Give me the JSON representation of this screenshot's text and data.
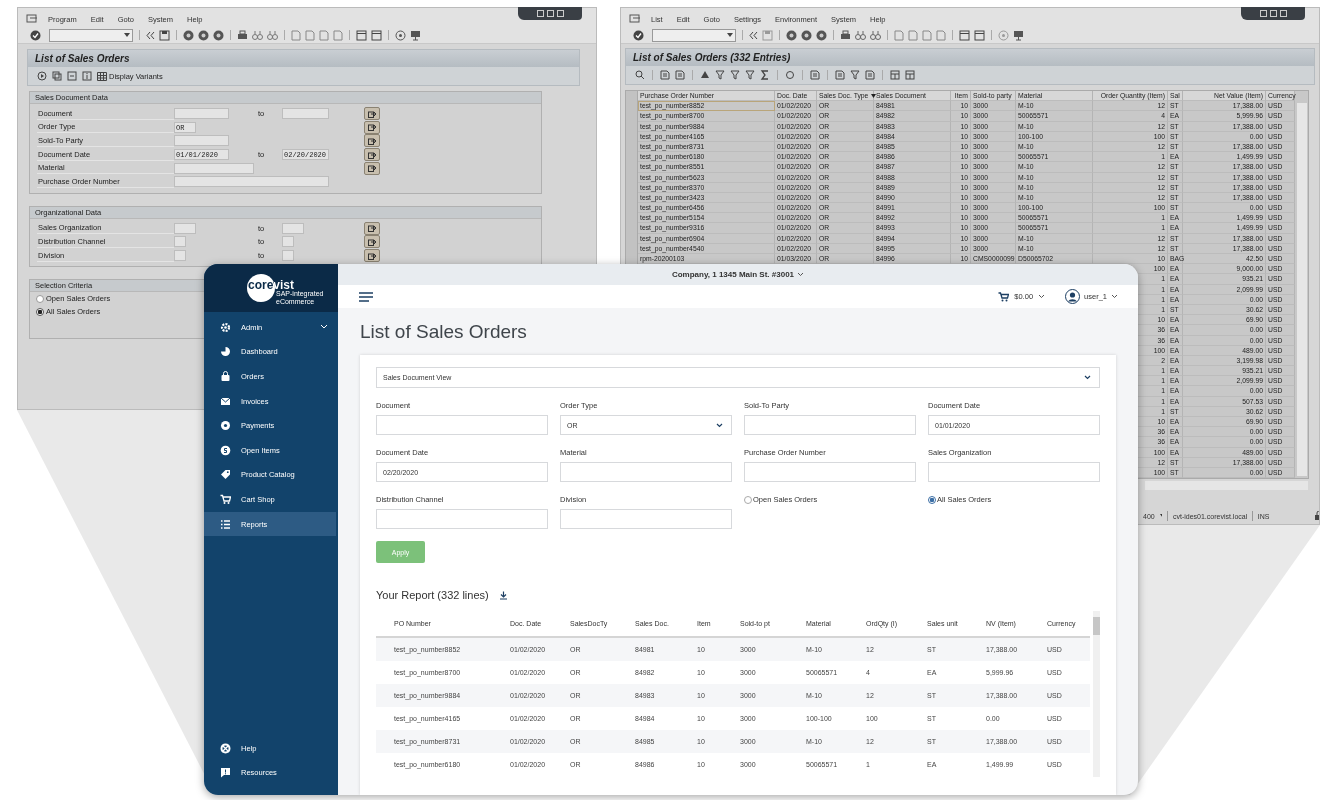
{
  "sap_selection_window": {
    "menu": [
      "Program",
      "Edit",
      "Goto",
      "System",
      "Help"
    ],
    "title": "List of Sales Orders",
    "toolbar_label": "Display Variants",
    "sections": [
      {
        "title": "Sales Document Data",
        "fields": [
          {
            "label": "Document",
            "to_label": "to",
            "multi_select": true
          },
          {
            "label": "Order Type",
            "from": "OR",
            "multi_select": true
          },
          {
            "label": "Sold-To Party",
            "multi_select": true
          },
          {
            "label": "Document Date",
            "from": "01/01/2020",
            "to_label": "to",
            "to": "02/20/2020",
            "multi_select": true
          },
          {
            "label": "Material",
            "multi_select": true
          },
          {
            "label": "Purchase Order Number",
            "multi_select": false
          }
        ]
      },
      {
        "title": "Organizational Data",
        "fields": [
          {
            "label": "Sales Organization",
            "to_label": "to",
            "multi_select": true
          },
          {
            "label": "Distribution Channel",
            "to_label": "to",
            "multi_select": true
          },
          {
            "label": "Division",
            "to_label": "to",
            "multi_select": true
          }
        ]
      }
    ],
    "selection_criteria": {
      "title": "Selection Criteria",
      "options": [
        {
          "label": "Open Sales Orders",
          "selected": false
        },
        {
          "label": "All Sales Orders",
          "selected": true
        }
      ]
    }
  },
  "sap_list_window": {
    "menu": [
      "List",
      "Edit",
      "Goto",
      "Settings",
      "Environment",
      "System",
      "Help"
    ],
    "title": "List of Sales Orders (332 Entries)",
    "columns": [
      "Purchase Order Number",
      "Doc. Date",
      "Sales Doc. Type",
      "Sales Document",
      "Item",
      "Sold-to party",
      "Material",
      "Order Quantity (Item)",
      "Sal",
      "Net Value (Item)",
      "Currency"
    ],
    "rows": [
      {
        "po": "test_po_number8852",
        "date": "01/02/2020",
        "type": "OR",
        "doc": "84981",
        "item": "10",
        "sold_to": "3000",
        "material": "M-10",
        "qty": "12",
        "unit": "ST",
        "net": "17,388.00",
        "currency": "USD"
      },
      {
        "po": "test_po_number8700",
        "date": "01/02/2020",
        "type": "OR",
        "doc": "84982",
        "item": "10",
        "sold_to": "3000",
        "material": "50065571",
        "qty": "4",
        "unit": "EA",
        "net": "5,999.96",
        "currency": "USD"
      },
      {
        "po": "test_po_number9884",
        "date": "01/02/2020",
        "type": "OR",
        "doc": "84983",
        "item": "10",
        "sold_to": "3000",
        "material": "M-10",
        "qty": "12",
        "unit": "ST",
        "net": "17,388.00",
        "currency": "USD"
      },
      {
        "po": "test_po_number4165",
        "date": "01/02/2020",
        "type": "OR",
        "doc": "84984",
        "item": "10",
        "sold_to": "3000",
        "material": "100-100",
        "qty": "100",
        "unit": "ST",
        "net": "0.00",
        "currency": "USD"
      },
      {
        "po": "test_po_number8731",
        "date": "01/02/2020",
        "type": "OR",
        "doc": "84985",
        "item": "10",
        "sold_to": "3000",
        "material": "M-10",
        "qty": "12",
        "unit": "ST",
        "net": "17,388.00",
        "currency": "USD"
      },
      {
        "po": "test_po_number6180",
        "date": "01/02/2020",
        "type": "OR",
        "doc": "84986",
        "item": "10",
        "sold_to": "3000",
        "material": "50065571",
        "qty": "1",
        "unit": "EA",
        "net": "1,499.99",
        "currency": "USD"
      },
      {
        "po": "test_po_number8551",
        "date": "01/02/2020",
        "type": "OR",
        "doc": "84987",
        "item": "10",
        "sold_to": "3000",
        "material": "M-10",
        "qty": "12",
        "unit": "ST",
        "net": "17,388.00",
        "currency": "USD"
      },
      {
        "po": "test_po_number5623",
        "date": "01/02/2020",
        "type": "OR",
        "doc": "84988",
        "item": "10",
        "sold_to": "3000",
        "material": "M-10",
        "qty": "12",
        "unit": "ST",
        "net": "17,388.00",
        "currency": "USD"
      },
      {
        "po": "test_po_number8370",
        "date": "01/02/2020",
        "type": "OR",
        "doc": "84989",
        "item": "10",
        "sold_to": "3000",
        "material": "M-10",
        "qty": "12",
        "unit": "ST",
        "net": "17,388.00",
        "currency": "USD"
      },
      {
        "po": "test_po_number3423",
        "date": "01/02/2020",
        "type": "OR",
        "doc": "84990",
        "item": "10",
        "sold_to": "3000",
        "material": "M-10",
        "qty": "12",
        "unit": "ST",
        "net": "17,388.00",
        "currency": "USD"
      },
      {
        "po": "test_po_number6456",
        "date": "01/02/2020",
        "type": "OR",
        "doc": "84991",
        "item": "10",
        "sold_to": "3000",
        "material": "100-100",
        "qty": "100",
        "unit": "ST",
        "net": "0.00",
        "currency": "USD"
      },
      {
        "po": "test_po_number5154",
        "date": "01/02/2020",
        "type": "OR",
        "doc": "84992",
        "item": "10",
        "sold_to": "3000",
        "material": "50065571",
        "qty": "1",
        "unit": "EA",
        "net": "1,499.99",
        "currency": "USD"
      },
      {
        "po": "test_po_number9316",
        "date": "01/02/2020",
        "type": "OR",
        "doc": "84993",
        "item": "10",
        "sold_to": "3000",
        "material": "50065571",
        "qty": "1",
        "unit": "EA",
        "net": "1,499.99",
        "currency": "USD"
      },
      {
        "po": "test_po_number6904",
        "date": "01/02/2020",
        "type": "OR",
        "doc": "84994",
        "item": "10",
        "sold_to": "3000",
        "material": "M-10",
        "qty": "12",
        "unit": "ST",
        "net": "17,388.00",
        "currency": "USD"
      },
      {
        "po": "test_po_number4540",
        "date": "01/02/2020",
        "type": "OR",
        "doc": "84995",
        "item": "10",
        "sold_to": "3000",
        "material": "M-10",
        "qty": "12",
        "unit": "ST",
        "net": "17,388.00",
        "currency": "USD"
      },
      {
        "po": "rpm-20200103",
        "date": "01/03/2020",
        "type": "OR",
        "doc": "84996",
        "item": "10",
        "sold_to": "CMS0000099",
        "material": "D50065702",
        "qty": "10",
        "unit": "BAG",
        "net": "42.50",
        "currency": "USD"
      },
      {
        "qty": "100",
        "unit": "EA",
        "net": "9,000.00",
        "currency": "USD"
      },
      {
        "qty": "1",
        "unit": "EA",
        "net": "935.21",
        "currency": "USD"
      },
      {
        "qty": "1",
        "unit": "EA",
        "net": "2,099.99",
        "currency": "USD"
      },
      {
        "qty": "1",
        "unit": "EA",
        "net": "0.00",
        "currency": "USD"
      },
      {
        "qty": "1",
        "unit": "ST",
        "net": "30.62",
        "currency": "USD"
      },
      {
        "qty": "10",
        "unit": "EA",
        "net": "69.90",
        "currency": "USD"
      },
      {
        "qty": "36",
        "unit": "EA",
        "net": "0.00",
        "currency": "USD"
      },
      {
        "qty": "36",
        "unit": "EA",
        "net": "0.00",
        "currency": "USD"
      },
      {
        "qty": "100",
        "unit": "EA",
        "net": "489.00",
        "currency": "USD"
      },
      {
        "qty": "2",
        "unit": "EA",
        "net": "3,199.98",
        "currency": "USD"
      },
      {
        "qty": "1",
        "unit": "EA",
        "net": "935.21",
        "currency": "USD"
      },
      {
        "qty": "1",
        "unit": "EA",
        "net": "2,099.99",
        "currency": "USD"
      },
      {
        "qty": "1",
        "unit": "EA",
        "net": "0.00",
        "currency": "USD"
      },
      {
        "qty": "1",
        "unit": "EA",
        "net": "507.53",
        "currency": "USD"
      },
      {
        "qty": "1",
        "unit": "ST",
        "net": "30.62",
        "currency": "USD"
      },
      {
        "qty": "10",
        "unit": "EA",
        "net": "69.90",
        "currency": "USD"
      },
      {
        "qty": "36",
        "unit": "EA",
        "net": "0.00",
        "currency": "USD"
      },
      {
        "qty": "36",
        "unit": "EA",
        "net": "0.00",
        "currency": "USD"
      },
      {
        "qty": "100",
        "unit": "EA",
        "net": "489.00",
        "currency": "USD"
      },
      {
        "qty": "12",
        "unit": "ST",
        "net": "17,388.00",
        "currency": "USD"
      },
      {
        "qty": "100",
        "unit": "ST",
        "net": "0.00",
        "currency": "USD"
      }
    ],
    "status_bar": {
      "client": "400",
      "host": "cvt-ides01.corevist.local",
      "mode": "INS"
    }
  },
  "app": {
    "logo": {
      "name": "corevist",
      "tagline": "SAP-integrated eCommerce"
    },
    "sidebar": {
      "items": [
        {
          "label": "Admin",
          "kind": "group",
          "selected": false
        },
        {
          "label": "Dashboard",
          "kind": "link",
          "selected": false
        },
        {
          "label": "Orders",
          "kind": "link",
          "selected": false
        },
        {
          "label": "Invoices",
          "kind": "link",
          "selected": false
        },
        {
          "label": "Payments",
          "kind": "link",
          "selected": false
        },
        {
          "label": "Open Items",
          "kind": "link",
          "selected": false
        },
        {
          "label": "Product Catalog",
          "kind": "link",
          "selected": false
        },
        {
          "label": "Cart Shop",
          "kind": "link",
          "selected": false
        },
        {
          "label": "Reports",
          "kind": "link",
          "selected": true
        }
      ],
      "bottom_items": [
        {
          "label": "Help"
        },
        {
          "label": "Resources"
        }
      ]
    },
    "company": "Company, 1 1345 Main St. #3001",
    "cart_total": "$0.00",
    "user": "user_1",
    "page_title": "List of Sales Orders",
    "view_select": "Sales Document View",
    "fields": [
      {
        "label": "Document",
        "kind": "input"
      },
      {
        "label": "Order Type",
        "kind": "select",
        "value": "OR"
      },
      {
        "label": "Sold-To Party",
        "kind": "input"
      },
      {
        "label": "Document Date",
        "kind": "input",
        "value": "01/01/2020"
      },
      {
        "label": "Document Date",
        "kind": "input",
        "value": "02/20/2020"
      },
      {
        "label": "Material",
        "kind": "input"
      },
      {
        "label": "Purchase Order Number",
        "kind": "input"
      },
      {
        "label": "Sales Organization",
        "kind": "input"
      },
      {
        "label": "Distribution Channel",
        "kind": "input"
      },
      {
        "label": "Division",
        "kind": "input"
      },
      {
        "label": "Open Sales Orders",
        "kind": "radio",
        "selected": false
      },
      {
        "label": "All Sales Orders",
        "kind": "radio",
        "selected": true
      }
    ],
    "apply_button": "Apply",
    "report_title": "Your Report (332 lines)",
    "table": {
      "columns": [
        "PO Number",
        "Doc. Date",
        "SalesDocTy",
        "Sales Doc.",
        "Item",
        "Sold-to pt",
        "Material",
        "OrdQty (I)",
        "Sales unit",
        "NV (Item)",
        "Currency"
      ],
      "rows": [
        [
          "test_po_number8852",
          "01/02/2020",
          "OR",
          "84981",
          "10",
          "3000",
          "M-10",
          "12",
          "ST",
          "17,388.00",
          "USD"
        ],
        [
          "test_po_number8700",
          "01/02/2020",
          "OR",
          "84982",
          "10",
          "3000",
          "50065571",
          "4",
          "EA",
          "5,999.96",
          "USD"
        ],
        [
          "test_po_number9884",
          "01/02/2020",
          "OR",
          "84983",
          "10",
          "3000",
          "M-10",
          "12",
          "ST",
          "17,388.00",
          "USD"
        ],
        [
          "test_po_number4165",
          "01/02/2020",
          "OR",
          "84984",
          "10",
          "3000",
          "100-100",
          "100",
          "ST",
          "0.00",
          "USD"
        ],
        [
          "test_po_number8731",
          "01/02/2020",
          "OR",
          "84985",
          "10",
          "3000",
          "M-10",
          "12",
          "ST",
          "17,388.00",
          "USD"
        ],
        [
          "test_po_number6180",
          "01/02/2020",
          "OR",
          "84986",
          "10",
          "3000",
          "50065571",
          "1",
          "EA",
          "1,499.99",
          "USD"
        ]
      ]
    }
  }
}
